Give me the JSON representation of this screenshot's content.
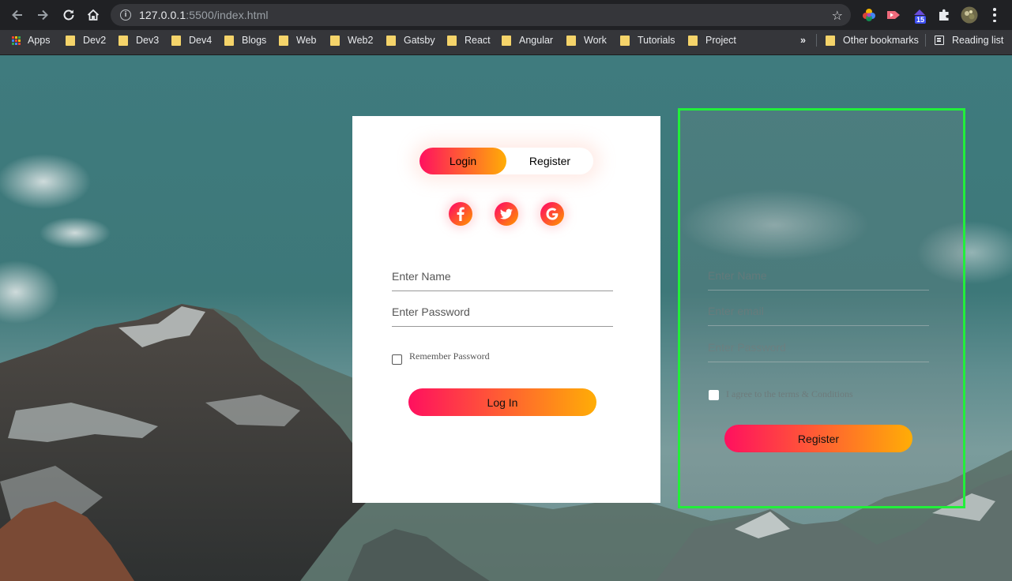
{
  "browser": {
    "url_host": "127.0.0.1",
    "url_rest": ":5500/index.html",
    "extension_badge": "15",
    "bookmarks": [
      {
        "label": "Apps"
      },
      {
        "label": "Dev2"
      },
      {
        "label": "Dev3"
      },
      {
        "label": "Dev4"
      },
      {
        "label": "Blogs"
      },
      {
        "label": "Web"
      },
      {
        "label": "Web2"
      },
      {
        "label": "Gatsby"
      },
      {
        "label": "React"
      },
      {
        "label": "Angular"
      },
      {
        "label": "Work"
      },
      {
        "label": "Tutorials"
      },
      {
        "label": "Project"
      }
    ],
    "overflow": "»",
    "other_bookmarks": "Other bookmarks",
    "reading_list": "Reading list"
  },
  "login": {
    "toggle_login": "Login",
    "toggle_register": "Register",
    "social": [
      "facebook-icon",
      "twitter-icon",
      "google-icon"
    ],
    "name_placeholder": "Enter Name",
    "password_placeholder": "Enter Password",
    "remember_label": "Remember Password",
    "submit_label": "Log In"
  },
  "register": {
    "name_placeholder": "Enter Name",
    "email_placeholder": "Enter email",
    "password_placeholder": "Enter Password",
    "terms_label": "I agree to the terms & Conditions",
    "submit_label": "Register"
  },
  "colors": {
    "gradient_start": "#ff105f",
    "gradient_end": "#ffad06",
    "highlight_border": "#22ef3a"
  }
}
